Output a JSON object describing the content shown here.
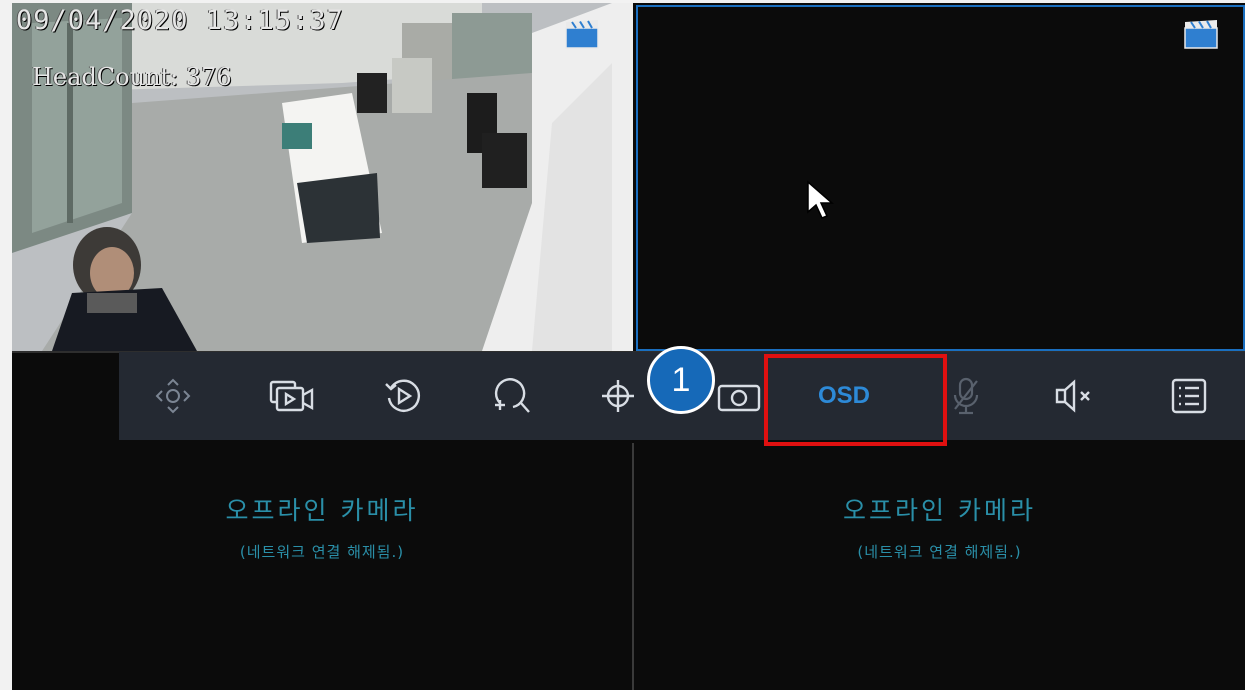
{
  "camera1": {
    "timestamp": "09/04/2020 13:15:37",
    "headcount": "HeadCount: 376",
    "record_icon": "clapperboard-icon"
  },
  "camera2": {
    "record_icon": "clapperboard-icon"
  },
  "offline": {
    "title": "오프라인 카메라",
    "subtitle": "(네트워크 연결 해제됨.)"
  },
  "toolbar": {
    "buttons": [
      {
        "icon": "ptz-icon"
      },
      {
        "icon": "playback-record-icon"
      },
      {
        "icon": "instant-playback-icon"
      },
      {
        "icon": "zoom-in-icon"
      },
      {
        "icon": "image-settings-icon"
      },
      {
        "icon": "snapshot-icon"
      },
      {
        "label": "OSD"
      },
      {
        "icon": "microphone-off-icon"
      },
      {
        "icon": "speaker-mute-icon"
      },
      {
        "icon": "menu-list-icon"
      }
    ]
  },
  "callout": {
    "number": "1"
  },
  "colors": {
    "highlight": "#e01010",
    "accent": "#1669b8",
    "offline_text": "#2a8fa8"
  }
}
